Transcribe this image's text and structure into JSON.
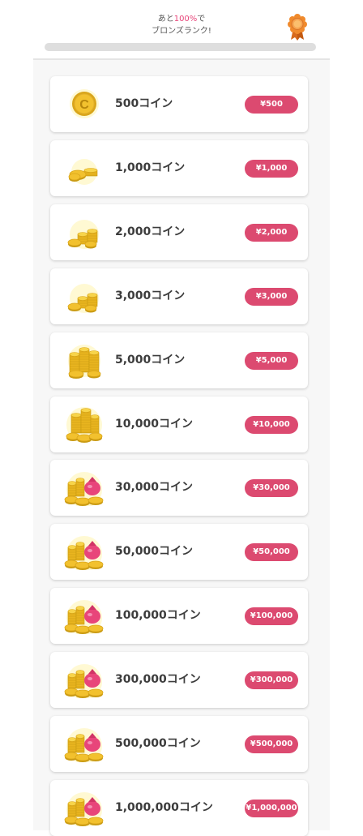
{
  "rank": {
    "prefix": "あと",
    "percent": "100%",
    "suffix": "で",
    "line2": "ブロンズランク!",
    "progress": 0,
    "medal_icon": "bronze-medal-icon"
  },
  "colors": {
    "accent": "#dc4a70",
    "percent_text": "#e8457a",
    "coin_gold": "#f2c12e",
    "bag_pink": "#e8457a"
  },
  "coins": [
    {
      "label": "500コイン",
      "price": "¥500",
      "icon": "single-coin-icon"
    },
    {
      "label": "1,000コイン",
      "price": "¥1,000",
      "icon": "coin-stack-small-icon"
    },
    {
      "label": "2,000コイン",
      "price": "¥2,000",
      "icon": "coin-stack-icon"
    },
    {
      "label": "3,000コイン",
      "price": "¥3,000",
      "icon": "coin-stack-icon"
    },
    {
      "label": "5,000コイン",
      "price": "¥5,000",
      "icon": "coin-stack-large-icon"
    },
    {
      "label": "10,000コイン",
      "price": "¥10,000",
      "icon": "coin-pile-icon"
    },
    {
      "label": "30,000コイン",
      "price": "¥30,000",
      "icon": "coin-bag-icon"
    },
    {
      "label": "50,000コイン",
      "price": "¥50,000",
      "icon": "coin-bag-icon"
    },
    {
      "label": "100,000コイン",
      "price": "¥100,000",
      "icon": "coin-bag-icon"
    },
    {
      "label": "300,000コイン",
      "price": "¥300,000",
      "icon": "coin-bag-icon"
    },
    {
      "label": "500,000コイン",
      "price": "¥500,000",
      "icon": "coin-bag-icon"
    },
    {
      "label": "1,000,000コイン",
      "price": "¥1,000,000",
      "icon": "coin-bag-icon"
    }
  ]
}
